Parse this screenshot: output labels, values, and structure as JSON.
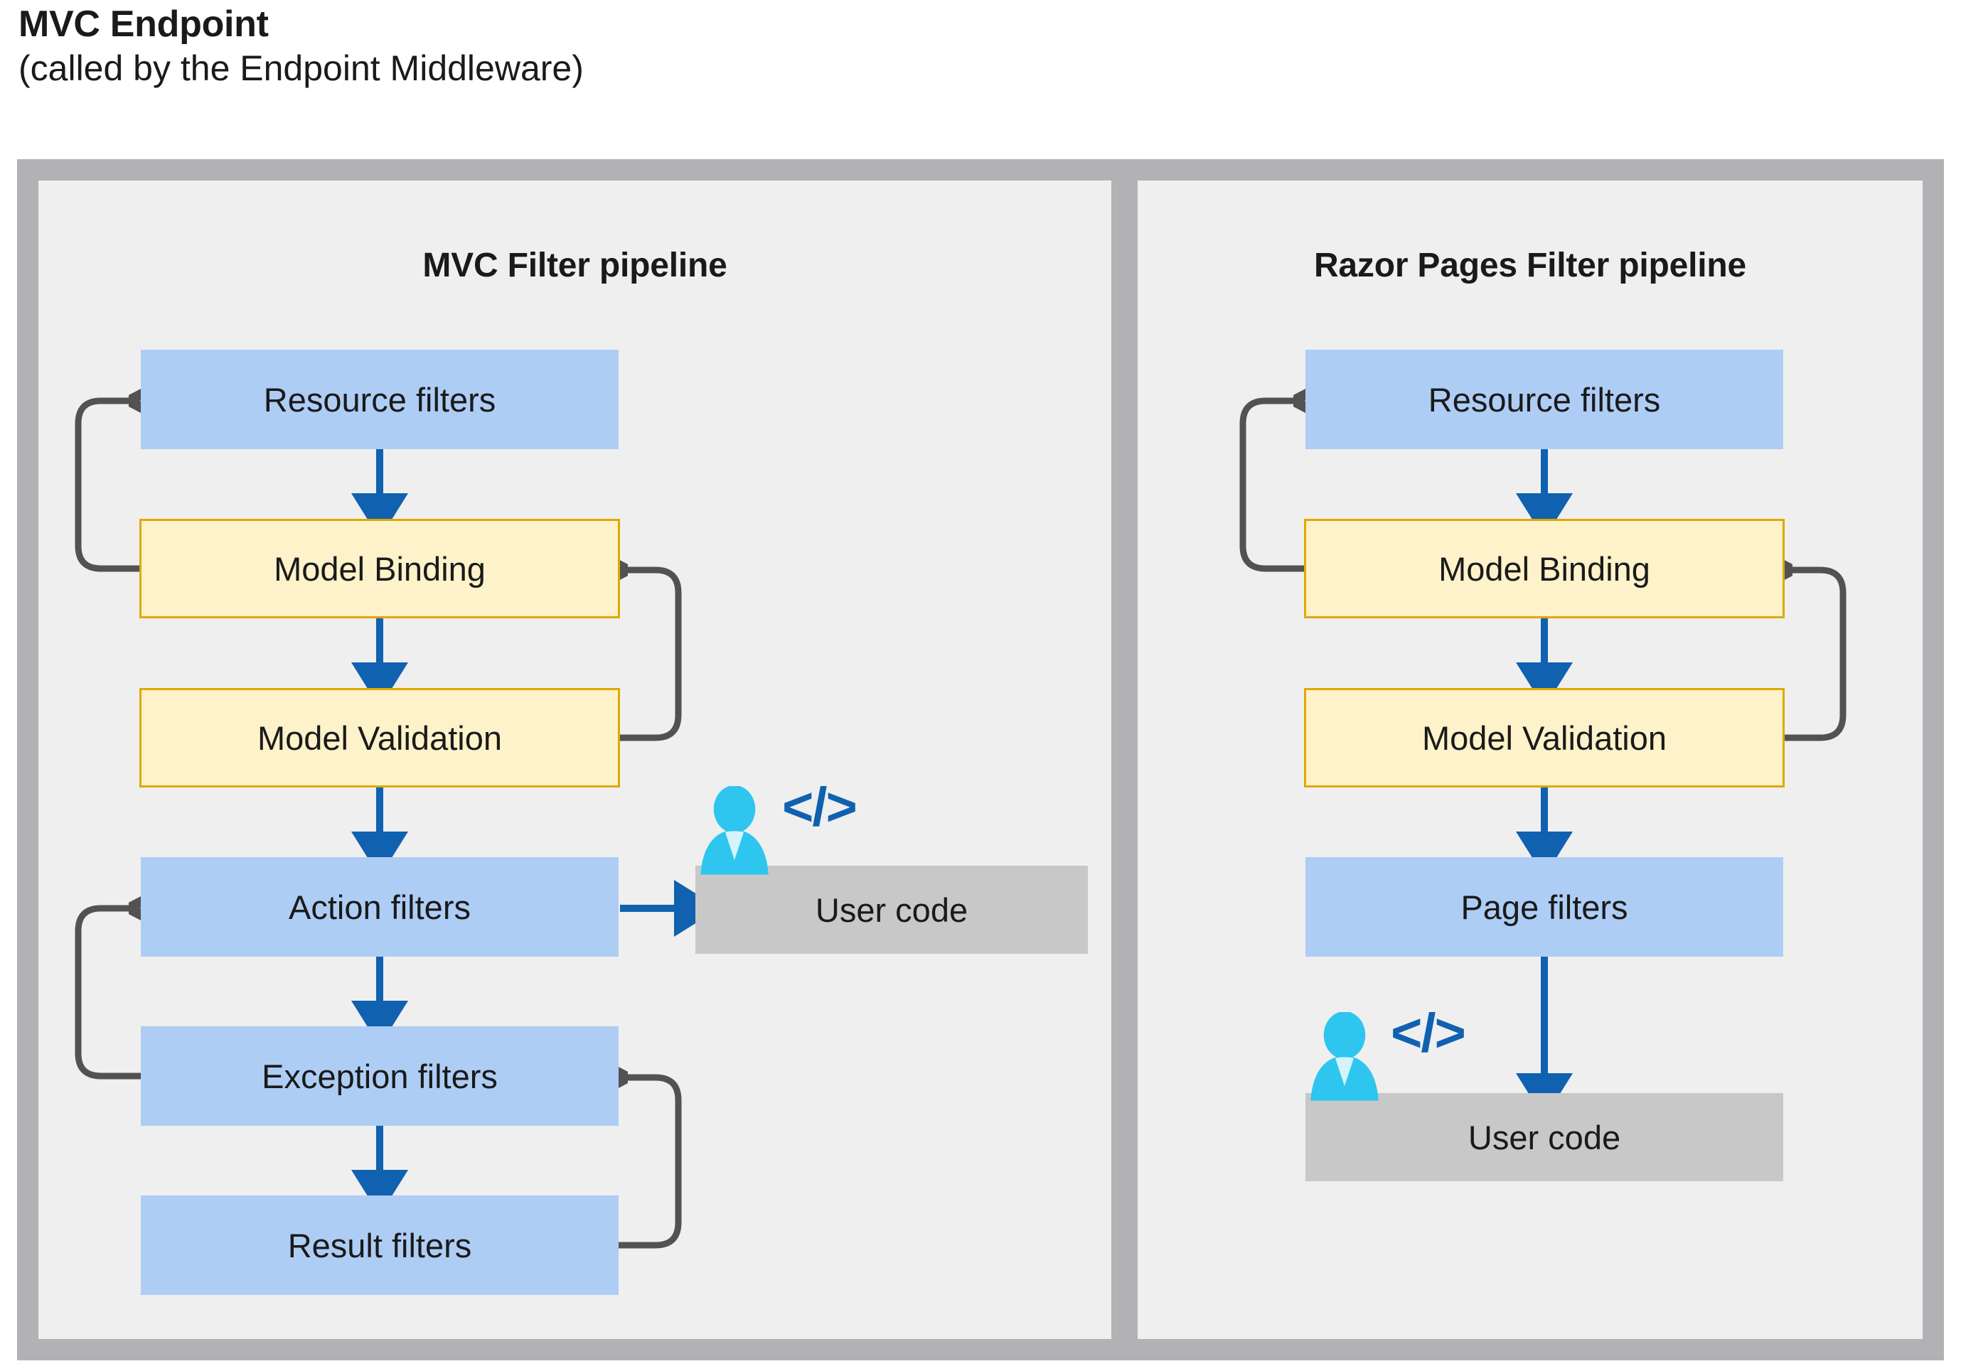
{
  "heading": {
    "title": "MVC Endpoint",
    "subtitle": "(called by the Endpoint Middleware)"
  },
  "colors": {
    "frame": "#b2b2b4",
    "panel_background": "#efefef",
    "filter_blue": "#aecdf5",
    "model_yellow_fill": "#fdf2c9",
    "model_yellow_border": "#e0a805",
    "user_code_gray": "#c8c8c8",
    "arrow_blue": "#1061b0",
    "loop_arrow_gray": "#525252",
    "person_cyan": "#2ec6ee",
    "text": "#1a1a1a"
  },
  "panels": [
    {
      "id": "mvc",
      "title": "MVC Filter pipeline",
      "nodes": [
        {
          "id": "mvc-resource-filters",
          "label": "Resource filters",
          "style": "blue"
        },
        {
          "id": "mvc-model-binding",
          "label": "Model Binding",
          "style": "yellow"
        },
        {
          "id": "mvc-model-validation",
          "label": "Model Validation",
          "style": "yellow"
        },
        {
          "id": "mvc-action-filters",
          "label": "Action filters",
          "style": "blue"
        },
        {
          "id": "mvc-exception-filters",
          "label": "Exception filters",
          "style": "blue"
        },
        {
          "id": "mvc-result-filters",
          "label": "Result filters",
          "style": "blue"
        },
        {
          "id": "mvc-user-code",
          "label": "User code",
          "style": "gray"
        }
      ],
      "icons": [
        {
          "id": "mvc-person",
          "name": "person-icon"
        },
        {
          "id": "mvc-code",
          "name": "code-brackets-icon",
          "glyph": "</>"
        }
      ]
    },
    {
      "id": "razor",
      "title": "Razor Pages Filter pipeline",
      "nodes": [
        {
          "id": "razor-resource-filters",
          "label": "Resource filters",
          "style": "blue"
        },
        {
          "id": "razor-model-binding",
          "label": "Model Binding",
          "style": "yellow"
        },
        {
          "id": "razor-model-validation",
          "label": "Model Validation",
          "style": "yellow"
        },
        {
          "id": "razor-page-filters",
          "label": "Page filters",
          "style": "blue"
        },
        {
          "id": "razor-user-code",
          "label": "User code",
          "style": "gray"
        }
      ],
      "icons": [
        {
          "id": "razor-person",
          "name": "person-icon"
        },
        {
          "id": "razor-code",
          "name": "code-brackets-icon",
          "glyph": "</>"
        }
      ]
    }
  ],
  "flows": {
    "mvc": [
      {
        "from": "Resource filters",
        "to": "Model Binding",
        "kind": "down-blue"
      },
      {
        "from": "Model Binding",
        "to": "Model Validation",
        "kind": "down-blue"
      },
      {
        "from": "Model Validation",
        "to": "Action filters",
        "kind": "down-blue"
      },
      {
        "from": "Action filters",
        "to": "Exception filters",
        "kind": "down-blue"
      },
      {
        "from": "Exception filters",
        "to": "Result filters",
        "kind": "down-blue"
      },
      {
        "from": "Action filters",
        "to": "User code",
        "kind": "right-blue"
      },
      {
        "from": "Model Binding",
        "to": "Resource filters",
        "kind": "loop-left"
      },
      {
        "from": "Exception filters",
        "to": "Action filters",
        "kind": "loop-left"
      },
      {
        "from": "Model Validation",
        "to": "Model Binding",
        "kind": "loop-right"
      },
      {
        "from": "Result filters",
        "to": "Exception filters",
        "kind": "loop-right"
      }
    ],
    "razor": [
      {
        "from": "Resource filters",
        "to": "Model Binding",
        "kind": "down-blue"
      },
      {
        "from": "Model Binding",
        "to": "Model Validation",
        "kind": "down-blue"
      },
      {
        "from": "Model Validation",
        "to": "Page filters",
        "kind": "down-blue"
      },
      {
        "from": "Page filters",
        "to": "User code",
        "kind": "down-blue"
      },
      {
        "from": "Model Binding",
        "to": "Resource filters",
        "kind": "loop-left"
      },
      {
        "from": "Model Validation",
        "to": "Model Binding",
        "kind": "loop-right"
      }
    ]
  }
}
